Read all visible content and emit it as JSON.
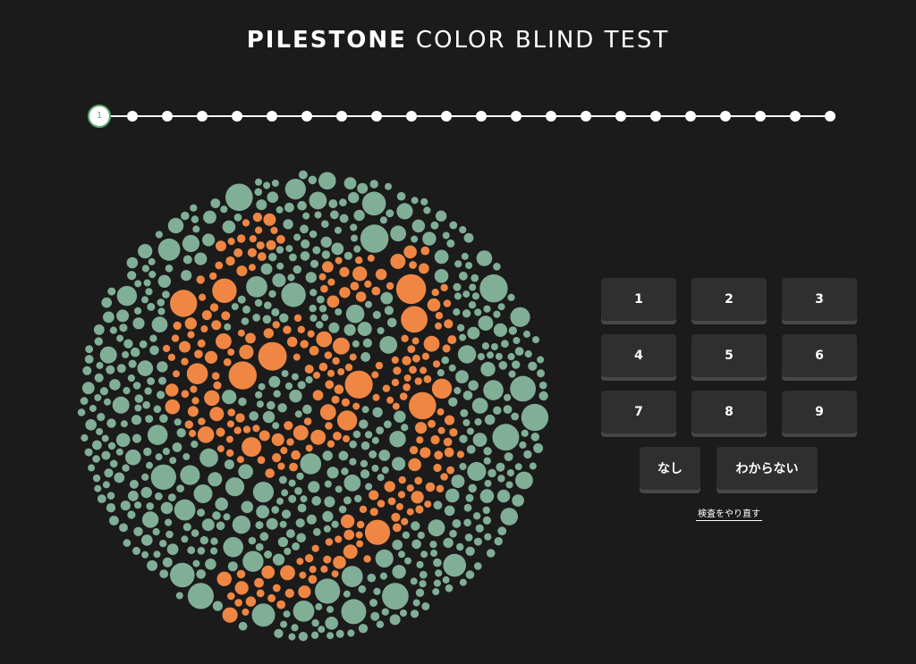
{
  "header": {
    "brand": "PILESTONE",
    "title": "COLOR BLIND TEST"
  },
  "progress": {
    "current_step_label": "1",
    "current_step": 1,
    "total_steps": 22
  },
  "answers": {
    "digits": [
      "1",
      "2",
      "3",
      "4",
      "5",
      "6",
      "7",
      "8",
      "9"
    ],
    "none_label": "なし",
    "unknown_label": "わからない",
    "retry_label": "検査をやり直す"
  },
  "plate": {
    "background_dot_color": "#81ae96",
    "figure_dot_color": "#ef8643"
  }
}
